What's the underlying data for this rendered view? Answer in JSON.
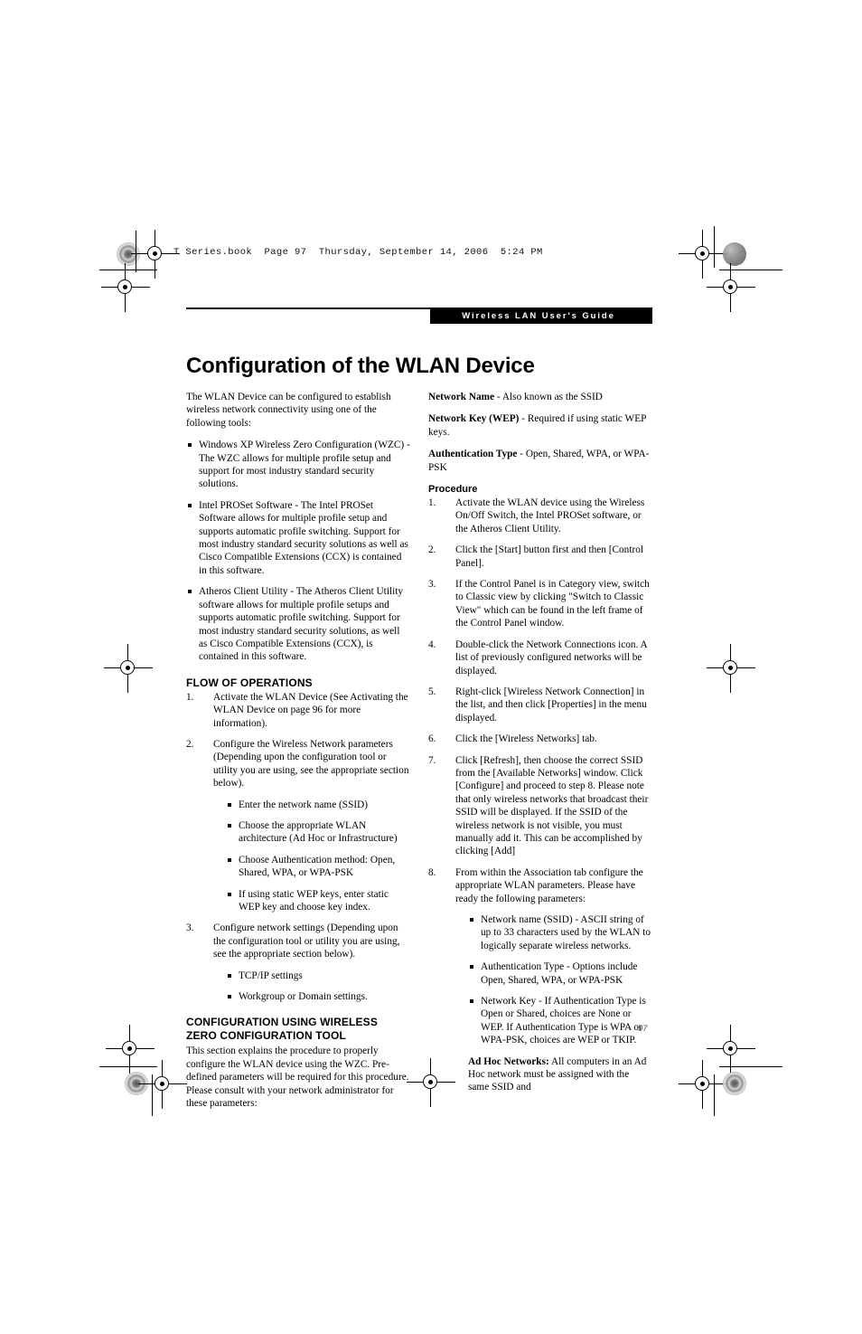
{
  "slug": "T Series.book  Page 97  Thursday, September 14, 2006  5:24 PM",
  "header": {
    "guide_tab": "Wireless LAN User's Guide"
  },
  "title": "Configuration of the WLAN Device",
  "page_number": "97",
  "left_column": {
    "intro": "The WLAN Device can be configured to establish wireless network connectivity using one of the following tools:",
    "tool_bullets": [
      "Windows XP Wireless Zero Configuration (WZC) - The WZC allows for multiple profile setup and support for most industry standard security solutions.",
      "Intel PROSet Software - The Intel PROSet Software allows for multiple profile setup and supports automatic profile switching. Support for most industry standard security solutions as well as Cisco Compatible Extensions (CCX) is contained in this software.",
      "Atheros Client Utility - The Atheros Client Utility software allows for multiple profile setups and supports automatic profile switching. Support for most industry standard security solutions, as well as Cisco Compatible Extensions (CCX), is contained in this software."
    ],
    "flow_heading": "FLOW OF OPERATIONS",
    "flow_steps": [
      {
        "num": "1.",
        "text": "Activate the WLAN Device (See Activating the WLAN Device on page 96 for more information)."
      },
      {
        "num": "2.",
        "text": "Configure the Wireless Network parameters (Depending upon the configuration tool or utility you are using, see the appropriate section below).",
        "sub_bullets": [
          "Enter the network name (SSID)",
          "Choose the appropriate WLAN architecture (Ad Hoc or Infrastructure)",
          "Choose Authentication method: Open, Shared, WPA, or WPA-PSK",
          "If using static WEP keys, enter static WEP key and choose key index."
        ]
      },
      {
        "num": "3.",
        "text": "Configure network settings (Depending upon the configuration tool or utility you are using, see the appropriate section below).",
        "sub_bullets": [
          "TCP/IP settings",
          "Workgroup or Domain settings."
        ]
      }
    ],
    "config_heading_line1": "CONFIGURATION USING WIRELESS",
    "config_heading_line2": "ZERO CONFIGURATION TOOL",
    "config_body": "This section explains the procedure to properly configure the WLAN device using the WZC. Pre-defined parameters will be required for this procedure. Please consult with your network administrator for these parameters:"
  },
  "right_column": {
    "params": [
      {
        "term": "Network Name",
        "desc": " - Also known as the SSID"
      },
      {
        "term": "Network Key (WEP)",
        "desc": " - Required if using static WEP keys."
      },
      {
        "term": "Authentication Type",
        "desc": " - Open, Shared, WPA, or WPA-PSK"
      }
    ],
    "procedure_heading": "Procedure",
    "procedure_steps": [
      {
        "num": "1.",
        "text": "Activate the WLAN device using the Wireless On/Off Switch, the Intel PROSet software, or the Atheros Client Utility."
      },
      {
        "num": "2.",
        "text": "Click the [Start] button first and then [Control Panel]."
      },
      {
        "num": "3.",
        "text": "If the Control Panel is in Category view, switch to Classic view by clicking \"Switch to Classic View\" which can be found in the left frame of the Control Panel window."
      },
      {
        "num": "4.",
        "text": "Double-click the Network Connections icon. A list of previously configured networks will be displayed."
      },
      {
        "num": "5.",
        "text": "Right-click [Wireless Network Connection] in the list, and then click [Properties] in the menu displayed."
      },
      {
        "num": "6.",
        "text": "Click the [Wireless Networks] tab."
      },
      {
        "num": "7.",
        "text": "Click [Refresh], then choose the correct SSID from the [Available Networks] window. Click [Configure] and proceed to step 8. Please note that only wireless networks that broadcast their SSID will be displayed. If the SSID of the wireless network is not visible, you must manually add it. This can be accomplished by clicking [Add]"
      },
      {
        "num": "8.",
        "text": "From within the Association tab configure the appropriate WLAN parameters. Please have ready the following parameters:",
        "sub_bullets": [
          "Network name (SSID) - ASCII string of up to 33 characters used by the WLAN to logically separate wireless networks.",
          "Authentication Type - Options include Open, Shared, WPA, or WPA-PSK",
          "Network Key - If Authentication Type is Open or Shared, choices are None or WEP. If Authentication Type is WPA or WPA-PSK, choices are WEP or TKIP."
        ]
      }
    ],
    "adhoc_term": "Ad Hoc Networks:",
    "adhoc_text": " All computers in an Ad Hoc network must be assigned with the same SSID and"
  }
}
